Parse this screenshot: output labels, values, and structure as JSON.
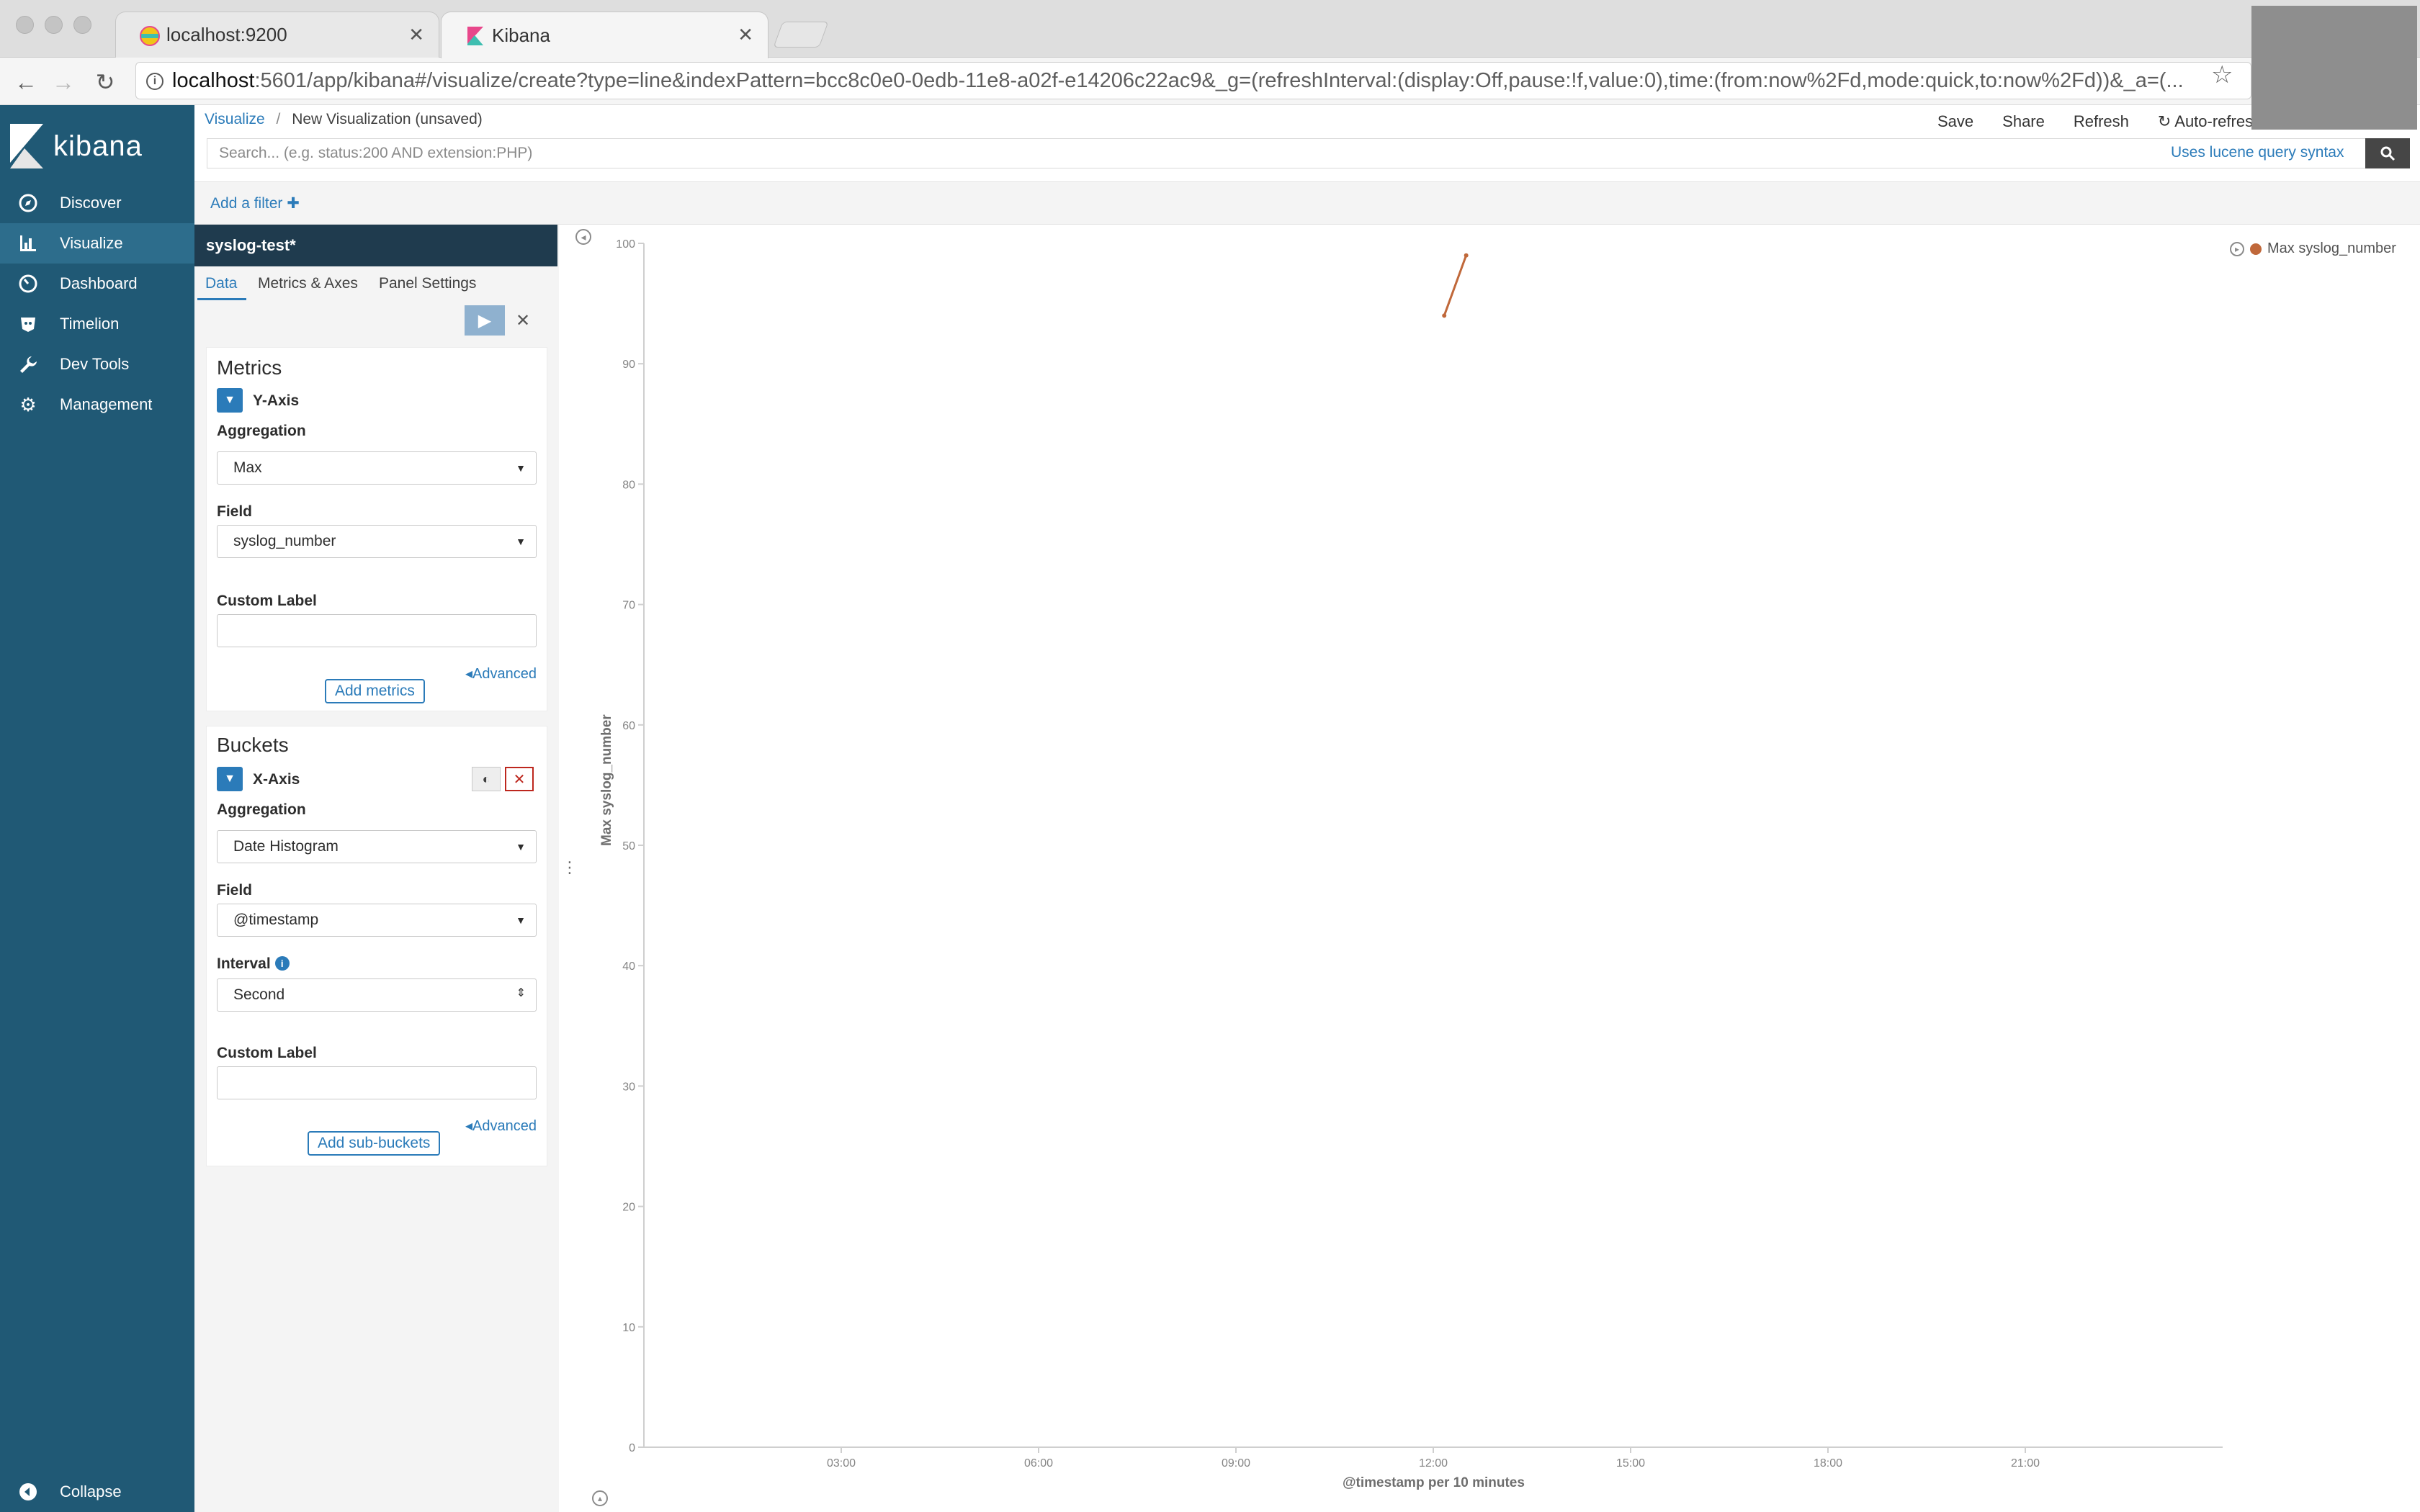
{
  "browser": {
    "tabs": [
      {
        "title": "localhost:9200",
        "active": false
      },
      {
        "title": "Kibana",
        "active": true
      }
    ],
    "url_host": "localhost",
    "url_rest": ":5601/app/kibana#/visualize/create?type=line&indexPattern=bcc8c0e0-0edb-11e8-a02f-e14206c22ac9&_g=(refreshInterval:(display:Off,pause:!f,value:0),time:(from:now%2Fd,mode:quick,to:now%2Fd))&_a=(..."
  },
  "sidebar": {
    "brand": "kibana",
    "items": [
      {
        "label": "Discover",
        "icon": "compass-icon"
      },
      {
        "label": "Visualize",
        "icon": "bar-chart-icon",
        "active": true
      },
      {
        "label": "Dashboard",
        "icon": "dashboard-icon"
      },
      {
        "label": "Timelion",
        "icon": "timelion-icon"
      },
      {
        "label": "Dev Tools",
        "icon": "wrench-icon"
      },
      {
        "label": "Management",
        "icon": "gear-icon"
      }
    ],
    "collapse": "Collapse"
  },
  "header": {
    "breadcrumb_link": "Visualize",
    "breadcrumb_sep": "/",
    "breadcrumb_current": "New Visualization (unsaved)",
    "actions": [
      "Save",
      "Share",
      "Refresh",
      "Auto-refresh"
    ],
    "search_placeholder": "Search... (e.g. status:200 AND extension:PHP)",
    "lucene": "Uses lucene query syntax",
    "add_filter": "Add a filter"
  },
  "editor": {
    "index_pattern": "syslog-test*",
    "tabs": [
      "Data",
      "Metrics & Axes",
      "Panel Settings"
    ],
    "metrics": {
      "title": "Metrics",
      "axis": "Y-Axis",
      "aggregation_label": "Aggregation",
      "aggregation_value": "Max",
      "field_label": "Field",
      "field_value": "syslog_number",
      "custom_label": "Custom Label",
      "advanced": "Advanced",
      "add_button": "Add metrics"
    },
    "buckets": {
      "title": "Buckets",
      "axis": "X-Axis",
      "aggregation_label": "Aggregation",
      "aggregation_value": "Date Histogram",
      "field_label": "Field",
      "field_value": "@timestamp",
      "interval_label": "Interval",
      "interval_value": "Second",
      "custom_label": "Custom Label",
      "advanced": "Advanced",
      "add_button": "Add sub-buckets"
    }
  },
  "chart_data": {
    "type": "line",
    "series": [
      {
        "name": "Max syslog_number",
        "color": "#c0683a",
        "x": [
          "12:10",
          "12:30"
        ],
        "y": [
          94,
          99
        ]
      }
    ],
    "ylabel": "Max syslog_number",
    "xlabel": "@timestamp per 10 minutes",
    "ylim": [
      0,
      100
    ],
    "yticks": [
      0,
      10,
      20,
      30,
      40,
      50,
      60,
      70,
      80,
      90,
      100
    ],
    "x_ticks": [
      "03:00",
      "06:00",
      "09:00",
      "12:00",
      "15:00",
      "18:00",
      "21:00"
    ],
    "x_range_hours": [
      0,
      24
    ],
    "legend": "top-right"
  }
}
